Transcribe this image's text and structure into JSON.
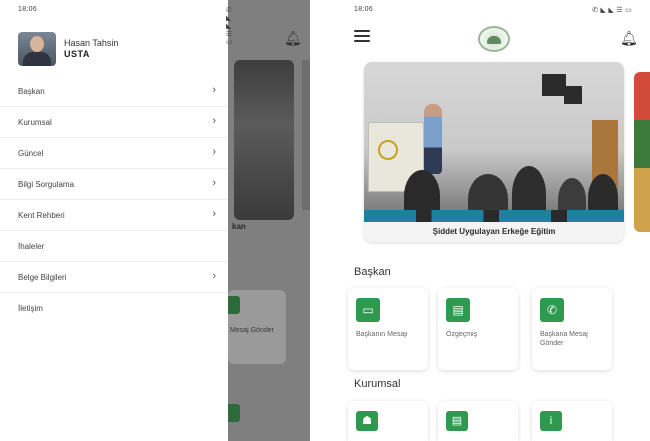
{
  "left_phone": {
    "status_time": "18:06",
    "status_icons": "✆ ◣ ◣ ☰ ▭",
    "profile": {
      "first_name": "Hasan Tahsin",
      "last_name": "USTA"
    },
    "menu": [
      {
        "label": "Başkan",
        "has_submenu": true
      },
      {
        "label": "Kurumsal",
        "has_submenu": true
      },
      {
        "label": "Güncel",
        "has_submenu": true
      },
      {
        "label": "Bilgi Sorgulama",
        "has_submenu": true
      },
      {
        "label": "Kent Rehberi",
        "has_submenu": true
      },
      {
        "label": "İhaleler",
        "has_submenu": false
      },
      {
        "label": "Belge Bilgileri",
        "has_submenu": true
      },
      {
        "label": "İletişim",
        "has_submenu": false
      }
    ],
    "background_peek": {
      "caption_fragment": "kan",
      "tile_text_fragment": "Mesaj Gönder"
    }
  },
  "right_phone": {
    "status_time": "18:06",
    "status_icons": "✆ ◣ ◣ ☰ ▭",
    "slider": {
      "caption": "Şiddet Uygulayan Erkeğe Eğitim"
    },
    "sections": [
      {
        "title": "Başkan",
        "tiles": [
          {
            "label": "Başkanın Mesajı",
            "icon": "chat-bubble-icon",
            "glyph": "▭"
          },
          {
            "label": "Özgeçmiş",
            "icon": "document-icon",
            "glyph": "▤"
          },
          {
            "label": "Başkana Mesaj Gönder",
            "icon": "phone-icon",
            "glyph": "✆"
          }
        ]
      },
      {
        "title": "Kurumsal",
        "tiles": [
          {
            "label": "",
            "icon": "person-icon",
            "glyph": "☗"
          },
          {
            "label": "",
            "icon": "document-icon",
            "glyph": "▤"
          },
          {
            "label": "",
            "icon": "info-icon",
            "glyph": "i"
          }
        ]
      }
    ]
  },
  "colors": {
    "accent_green": "#2e9a4f",
    "scrim_gray": "#7f7f7f"
  }
}
